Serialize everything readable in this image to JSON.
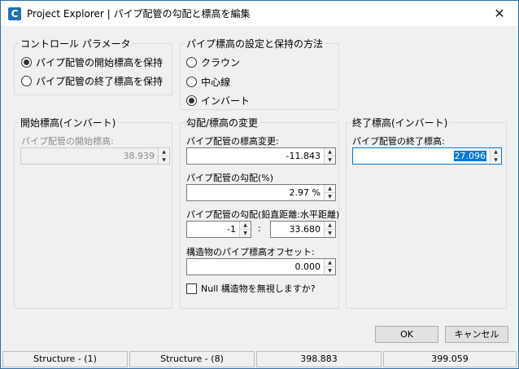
{
  "window": {
    "title": "Project Explorer | パイプ配管の勾配と標高を編集",
    "app_icon_letter": "C",
    "close_glyph": "✕"
  },
  "control_params": {
    "legend": "コントロール パラメータ",
    "options": [
      {
        "label": "パイプ配管の開始標高を保持",
        "selected": true
      },
      {
        "label": "パイプ配管の終了標高を保持",
        "selected": false
      }
    ]
  },
  "pipe_elevation_method": {
    "legend": "パイプ標高の設定と保持の方法",
    "options": [
      {
        "label": "クラウン",
        "selected": false
      },
      {
        "label": "中心線",
        "selected": false
      },
      {
        "label": "インバート",
        "selected": true
      }
    ]
  },
  "start_elevation": {
    "legend": "開始標高(インバート)",
    "label": "パイプ配管の開始標高:",
    "value": "38.939",
    "enabled": false
  },
  "slope_change": {
    "legend": "勾配/標高の変更",
    "elevation_change_label": "パイプ配管の標高変更:",
    "elevation_change_value": "-11.843",
    "slope_pct_label": "パイプ配管の勾配(%)",
    "slope_pct_value": "2.97 %",
    "slope_ratio_label": "パイプ配管の勾配(鉛直距離:水平距離)",
    "slope_vertical_value": "-1",
    "slope_separator": ":",
    "slope_horizontal_value": "33.680",
    "offset_label": "構造物のパイプ標高オフセット:",
    "offset_value": "0.000",
    "ignore_null_label": "Null 構造物を無視しますか?",
    "ignore_null_checked": false
  },
  "end_elevation": {
    "legend": "終了標高(インバート)",
    "label": "パイプ配管の終了標高:",
    "value": "27.096"
  },
  "buttons": {
    "ok": "OK",
    "cancel": "キャンセル"
  },
  "status_bar": [
    "Structure - (1)",
    "Structure - (8)",
    "398.883",
    "399.059"
  ],
  "colors": {
    "accent": "#0078d7",
    "window_border": "#2b6ea8",
    "disabled_text": "#8c8c8c"
  }
}
